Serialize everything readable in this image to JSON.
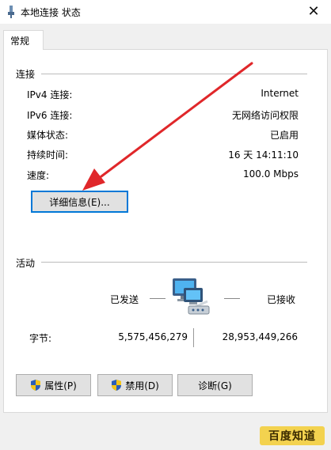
{
  "window": {
    "title": "本地连接 状态",
    "close_glyph": "✕"
  },
  "tabs": [
    {
      "label": "常规"
    }
  ],
  "connection": {
    "section_label": "连接",
    "rows": [
      {
        "label": "IPv4 连接:",
        "value": "Internet"
      },
      {
        "label": "IPv6 连接:",
        "value": "无网络访问权限"
      },
      {
        "label": "媒体状态:",
        "value": "已启用"
      },
      {
        "label": "持续时间:",
        "value": "16 天 14:11:10"
      },
      {
        "label": "速度:",
        "value": "100.0 Mbps"
      }
    ],
    "details_button": "详细信息(E)..."
  },
  "activity": {
    "section_label": "活动",
    "sent_label": "已发送",
    "received_label": "已接收",
    "bytes_label": "字节:",
    "bytes_sent": "5,575,456,279",
    "bytes_received": "28,953,449,266"
  },
  "buttons": {
    "properties": "属性(P)",
    "disable": "禁用(D)",
    "diagnose": "诊断(G)"
  },
  "watermark": "百度知道",
  "colors": {
    "arrow": "#e0272a",
    "focus": "#0078d7",
    "watermark_bg": "#f3d24f"
  },
  "icons": [
    "network-status-icon",
    "close-icon",
    "network-computers-icon",
    "shield-icon"
  ]
}
